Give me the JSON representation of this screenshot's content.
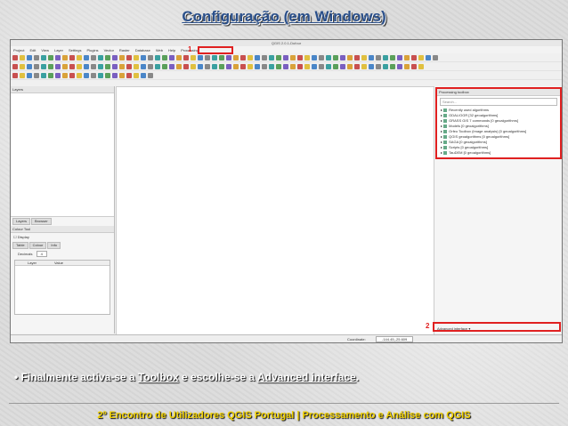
{
  "slide": {
    "title": "Configuração (em Windows)",
    "bullet_pre": "Finalmente activa-se a ",
    "bullet_link1": "Toolbox",
    "bullet_mid": " e escolhe-se a ",
    "bullet_link2": "Advanced interface",
    "bullet_end": ".",
    "footer": "2º Encontro de Utilizadores QGIS Portugal   |   Processamento e Análise com QGIS"
  },
  "qgis": {
    "window_title": "QGIS 2.0.1-Dufour",
    "menu": [
      "Project",
      "Edit",
      "View",
      "Layer",
      "Settings",
      "Plugins",
      "Vector",
      "Raster",
      "Database",
      "Web",
      "Help",
      "Processing"
    ],
    "layers_panel_title": "Layers",
    "panel_tabs": [
      "Layers",
      "Browser"
    ],
    "color_tool_title": "Colour Tool",
    "display_label": "Display",
    "color_tabs": [
      "Table",
      "Colour",
      "Info"
    ],
    "decimals_label": "Decimals",
    "decimals_value": "4",
    "table_cols": [
      "Layer",
      "Value"
    ],
    "toolbox_title": "Processing toolbox",
    "toolbox_search": "Search...",
    "toolbox_items": [
      "Recently used algorithms",
      "GDAL/OGR [32 geoalgorithms]",
      "GRASS GIS 7 commands [0 geoalgorithms]",
      "Models [0 geoalgorithms]",
      "Orfeo Toolbox (Image analysis) [0 geoalgorithms]",
      "QGIS geoalgorithms [0 geoalgorithms]",
      "SAGA [0 geoalgorithms]",
      "Scripts [0 geoalgorithms]",
      "TauDEM [0 geoalgorithms]"
    ],
    "advanced_label": "Advanced interface",
    "coordinate_label": "Coordinate:",
    "coordinate_value": "-144.45,-25.609",
    "callout_1": "1",
    "callout_2": "2"
  }
}
